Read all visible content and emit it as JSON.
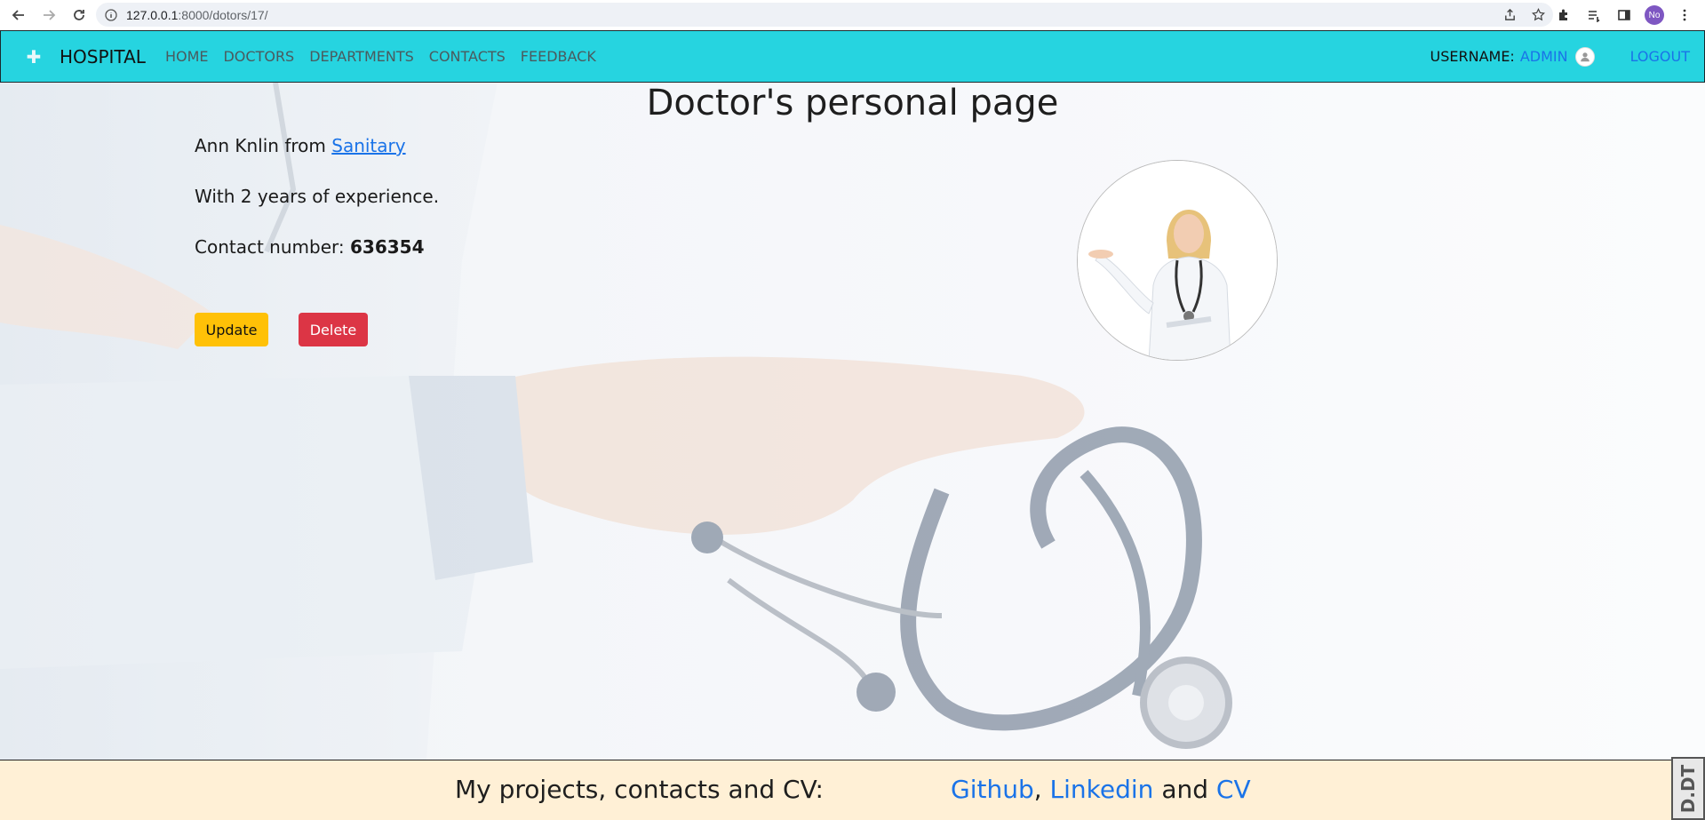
{
  "browser": {
    "url_host": "127.0.0.1",
    "url_rest": ":8000/dotors/17/",
    "profile_initials": "No"
  },
  "navbar": {
    "brand": "HOSPITAL",
    "links": [
      "HOME",
      "DOCTORS",
      "DEPARTMENTS",
      "CONTACTS",
      "FEEDBACK"
    ],
    "username_label": "USERNAME:",
    "username": "ADMIN",
    "logout": "LOGOUT"
  },
  "page": {
    "title": "Doctor's personal page",
    "doctor_name": "Ann Knlin",
    "from_word": "from",
    "department": "Sanitary",
    "experience": "With 2 years of experience.",
    "contact_label": "Contact number:",
    "contact_number": "636354",
    "update_label": "Update",
    "delete_label": "Delete"
  },
  "footer": {
    "label": "My projects, contacts and CV:",
    "github": "Github",
    "comma": ",",
    "linkedin": "Linkedin",
    "and_word": "and",
    "cv": "CV"
  },
  "badge": {
    "text": "D.DT"
  },
  "colors": {
    "navbar_bg": "#26d4e0",
    "link": "#1a73e8",
    "update_btn": "#ffc107",
    "delete_btn": "#dc3545",
    "footer_bg": "#fff0d6"
  }
}
